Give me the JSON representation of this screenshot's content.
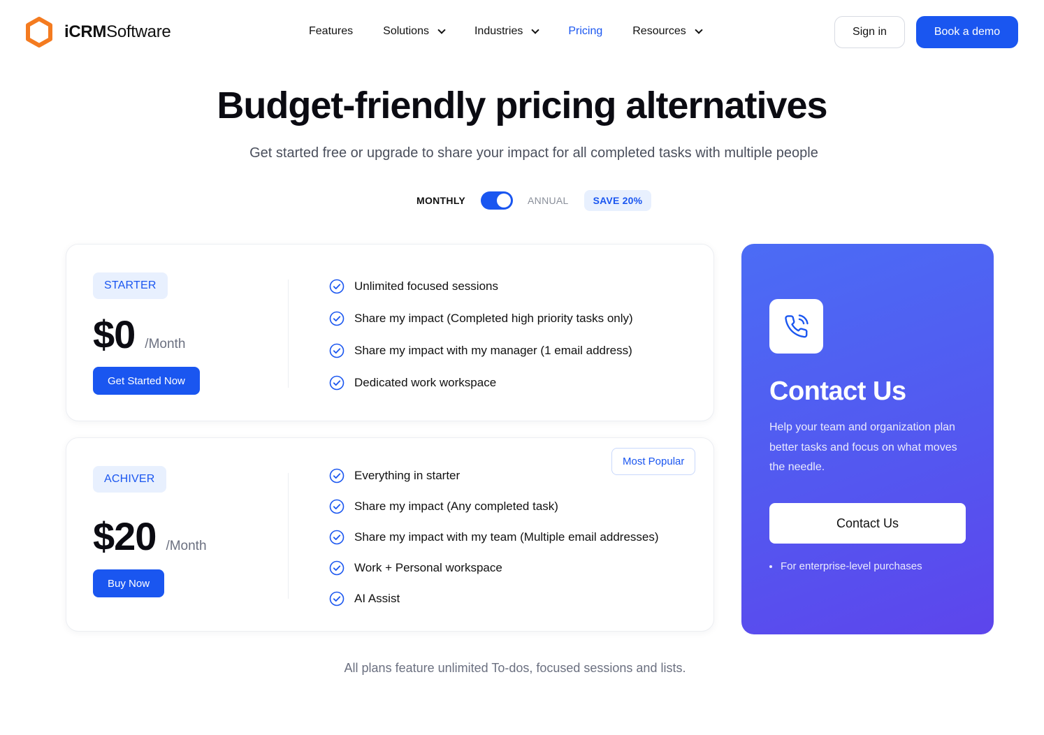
{
  "brand": {
    "name_bold": "iCRM",
    "name_regular": "Software",
    "accent_color": "#f47b20",
    "primary_color": "#1a56f0"
  },
  "nav": {
    "items": [
      {
        "label": "Features",
        "dropdown": false,
        "active": false
      },
      {
        "label": "Solutions",
        "dropdown": true,
        "active": false
      },
      {
        "label": "Industries",
        "dropdown": true,
        "active": false
      },
      {
        "label": "Pricing",
        "dropdown": false,
        "active": true
      },
      {
        "label": "Resources",
        "dropdown": true,
        "active": false
      }
    ],
    "sign_in": "Sign in",
    "book_demo": "Book a demo"
  },
  "hero": {
    "title": "Budget-friendly pricing alternatives",
    "subtitle": "Get started free or upgrade to share your impact for all completed tasks with multiple people"
  },
  "billing": {
    "monthly": "MONTHLY",
    "annual": "ANNUAL",
    "save": "SAVE 20%"
  },
  "plans": [
    {
      "badge": "STARTER",
      "price": "$0",
      "unit": "/Month",
      "button": "Get Started Now",
      "features": [
        "Unlimited focused sessions",
        "Share my impact (Completed high priority tasks only)",
        "Share my impact with my manager (1 email address)",
        "Dedicated work workspace"
      ]
    },
    {
      "badge": "ACHIVER",
      "price": "$20",
      "unit": "/Month",
      "button": "Buy Now",
      "popular": "Most Popular",
      "features": [
        "Everything in starter",
        "Share my impact (Any completed task)",
        "Share my impact with my team (Multiple email addresses)",
        "Work + Personal workspace",
        "AI Assist"
      ]
    }
  ],
  "contact": {
    "icon": "phone-call-icon",
    "title": "Contact Us",
    "description": "Help your team and organization plan better tasks and focus on what moves the needle.",
    "button": "Contact Us",
    "note": "For enterprise-level purchases"
  },
  "footer_note": "All plans feature unlimited To-dos, focused sessions and lists."
}
